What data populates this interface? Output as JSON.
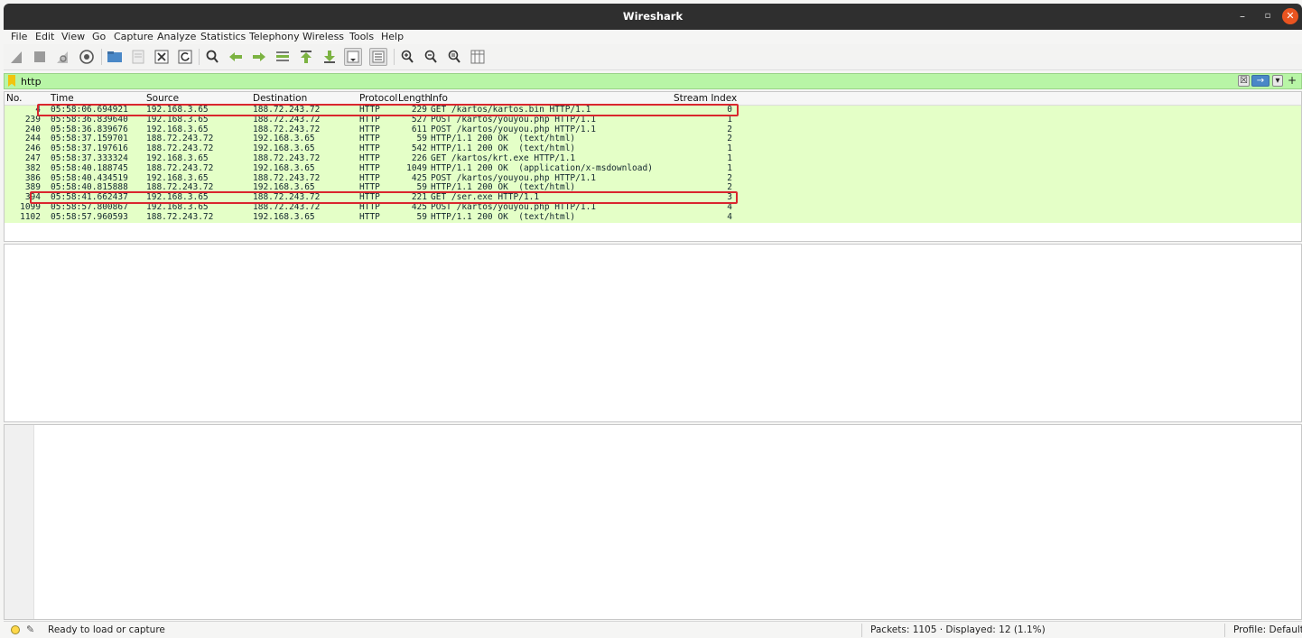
{
  "window": {
    "title": "Wireshark",
    "controls": {
      "minimize": "–",
      "maximize": "▫",
      "close": "✕"
    }
  },
  "menu": [
    "File",
    "Edit",
    "View",
    "Go",
    "Capture",
    "Analyze",
    "Statistics",
    "Telephony",
    "Wireless",
    "Tools",
    "Help"
  ],
  "toolbar": {
    "icons": [
      "shark-fin-start-icon",
      "stop-icon",
      "restart-capture-icon",
      "capture-options-icon",
      "open-file-icon",
      "save-file-icon",
      "close-file-icon",
      "reload-file-icon",
      "find-packet-icon",
      "go-back-icon",
      "go-forward-icon",
      "go-to-packet-icon",
      "go-first-icon",
      "go-last-icon",
      "autoscroll-icon",
      "colorize-icon",
      "zoom-in-icon",
      "zoom-out-icon",
      "normal-size-icon",
      "resize-columns-icon"
    ]
  },
  "filter": {
    "value": "http",
    "clear": "☒",
    "apply": "→",
    "dropdown": "▾",
    "add": "+"
  },
  "columns": {
    "no": "No.",
    "time": "Time",
    "source": "Source",
    "destination": "Destination",
    "protocol": "Protocol",
    "length": "Length",
    "info": "Info",
    "stream": "Stream Index"
  },
  "packets": [
    {
      "no": "4",
      "time": "05:58:06.694921",
      "src": "192.168.3.65",
      "dst": "188.72.243.72",
      "proto": "HTTP",
      "len": "229",
      "info": "GET /kartos/kartos.bin HTTP/1.1",
      "stream": "0"
    },
    {
      "no": "239",
      "time": "05:58:36.839640",
      "src": "192.168.3.65",
      "dst": "188.72.243.72",
      "proto": "HTTP",
      "len": "527",
      "info": "POST /kartos/youyou.php HTTP/1.1",
      "stream": "1"
    },
    {
      "no": "240",
      "time": "05:58:36.839676",
      "src": "192.168.3.65",
      "dst": "188.72.243.72",
      "proto": "HTTP",
      "len": "611",
      "info": "POST /kartos/youyou.php HTTP/1.1",
      "stream": "2"
    },
    {
      "no": "244",
      "time": "05:58:37.159701",
      "src": "188.72.243.72",
      "dst": "192.168.3.65",
      "proto": "HTTP",
      "len": "59",
      "info": "HTTP/1.1 200 OK  (text/html)",
      "stream": "2"
    },
    {
      "no": "246",
      "time": "05:58:37.197616",
      "src": "188.72.243.72",
      "dst": "192.168.3.65",
      "proto": "HTTP",
      "len": "542",
      "info": "HTTP/1.1 200 OK  (text/html)",
      "stream": "1"
    },
    {
      "no": "247",
      "time": "05:58:37.333324",
      "src": "192.168.3.65",
      "dst": "188.72.243.72",
      "proto": "HTTP",
      "len": "226",
      "info": "GET /kartos/krt.exe HTTP/1.1",
      "stream": "1"
    },
    {
      "no": "382",
      "time": "05:58:40.188745",
      "src": "188.72.243.72",
      "dst": "192.168.3.65",
      "proto": "HTTP",
      "len": "1049",
      "info": "HTTP/1.1 200 OK  (application/x-msdownload)",
      "stream": "1"
    },
    {
      "no": "386",
      "time": "05:58:40.434519",
      "src": "192.168.3.65",
      "dst": "188.72.243.72",
      "proto": "HTTP",
      "len": "425",
      "info": "POST /kartos/youyou.php HTTP/1.1",
      "stream": "2"
    },
    {
      "no": "389",
      "time": "05:58:40.815888",
      "src": "188.72.243.72",
      "dst": "192.168.3.65",
      "proto": "HTTP",
      "len": "59",
      "info": "HTTP/1.1 200 OK  (text/html)",
      "stream": "2"
    },
    {
      "no": "394",
      "time": "05:58:41.662437",
      "src": "192.168.3.65",
      "dst": "188.72.243.72",
      "proto": "HTTP",
      "len": "221",
      "info": "GET /ser.exe HTTP/1.1",
      "stream": "3"
    },
    {
      "no": "1099",
      "time": "05:58:57.800867",
      "src": "192.168.3.65",
      "dst": "188.72.243.72",
      "proto": "HTTP",
      "len": "425",
      "info": "POST /kartos/youyou.php HTTP/1.1",
      "stream": "4"
    },
    {
      "no": "1102",
      "time": "05:58:57.960593",
      "src": "188.72.243.72",
      "dst": "192.168.3.65",
      "proto": "HTTP",
      "len": "59",
      "info": "HTTP/1.1 200 OK  (text/html)",
      "stream": "4"
    }
  ],
  "highlighted_rows": [
    0,
    9
  ],
  "highlight_color": "#d9262e",
  "row_color": "#e4ffc7",
  "status": {
    "ready": "Ready to load or capture",
    "packets": "Packets: 1105 · Displayed: 12 (1.1%)",
    "profile": "Profile: Default"
  }
}
